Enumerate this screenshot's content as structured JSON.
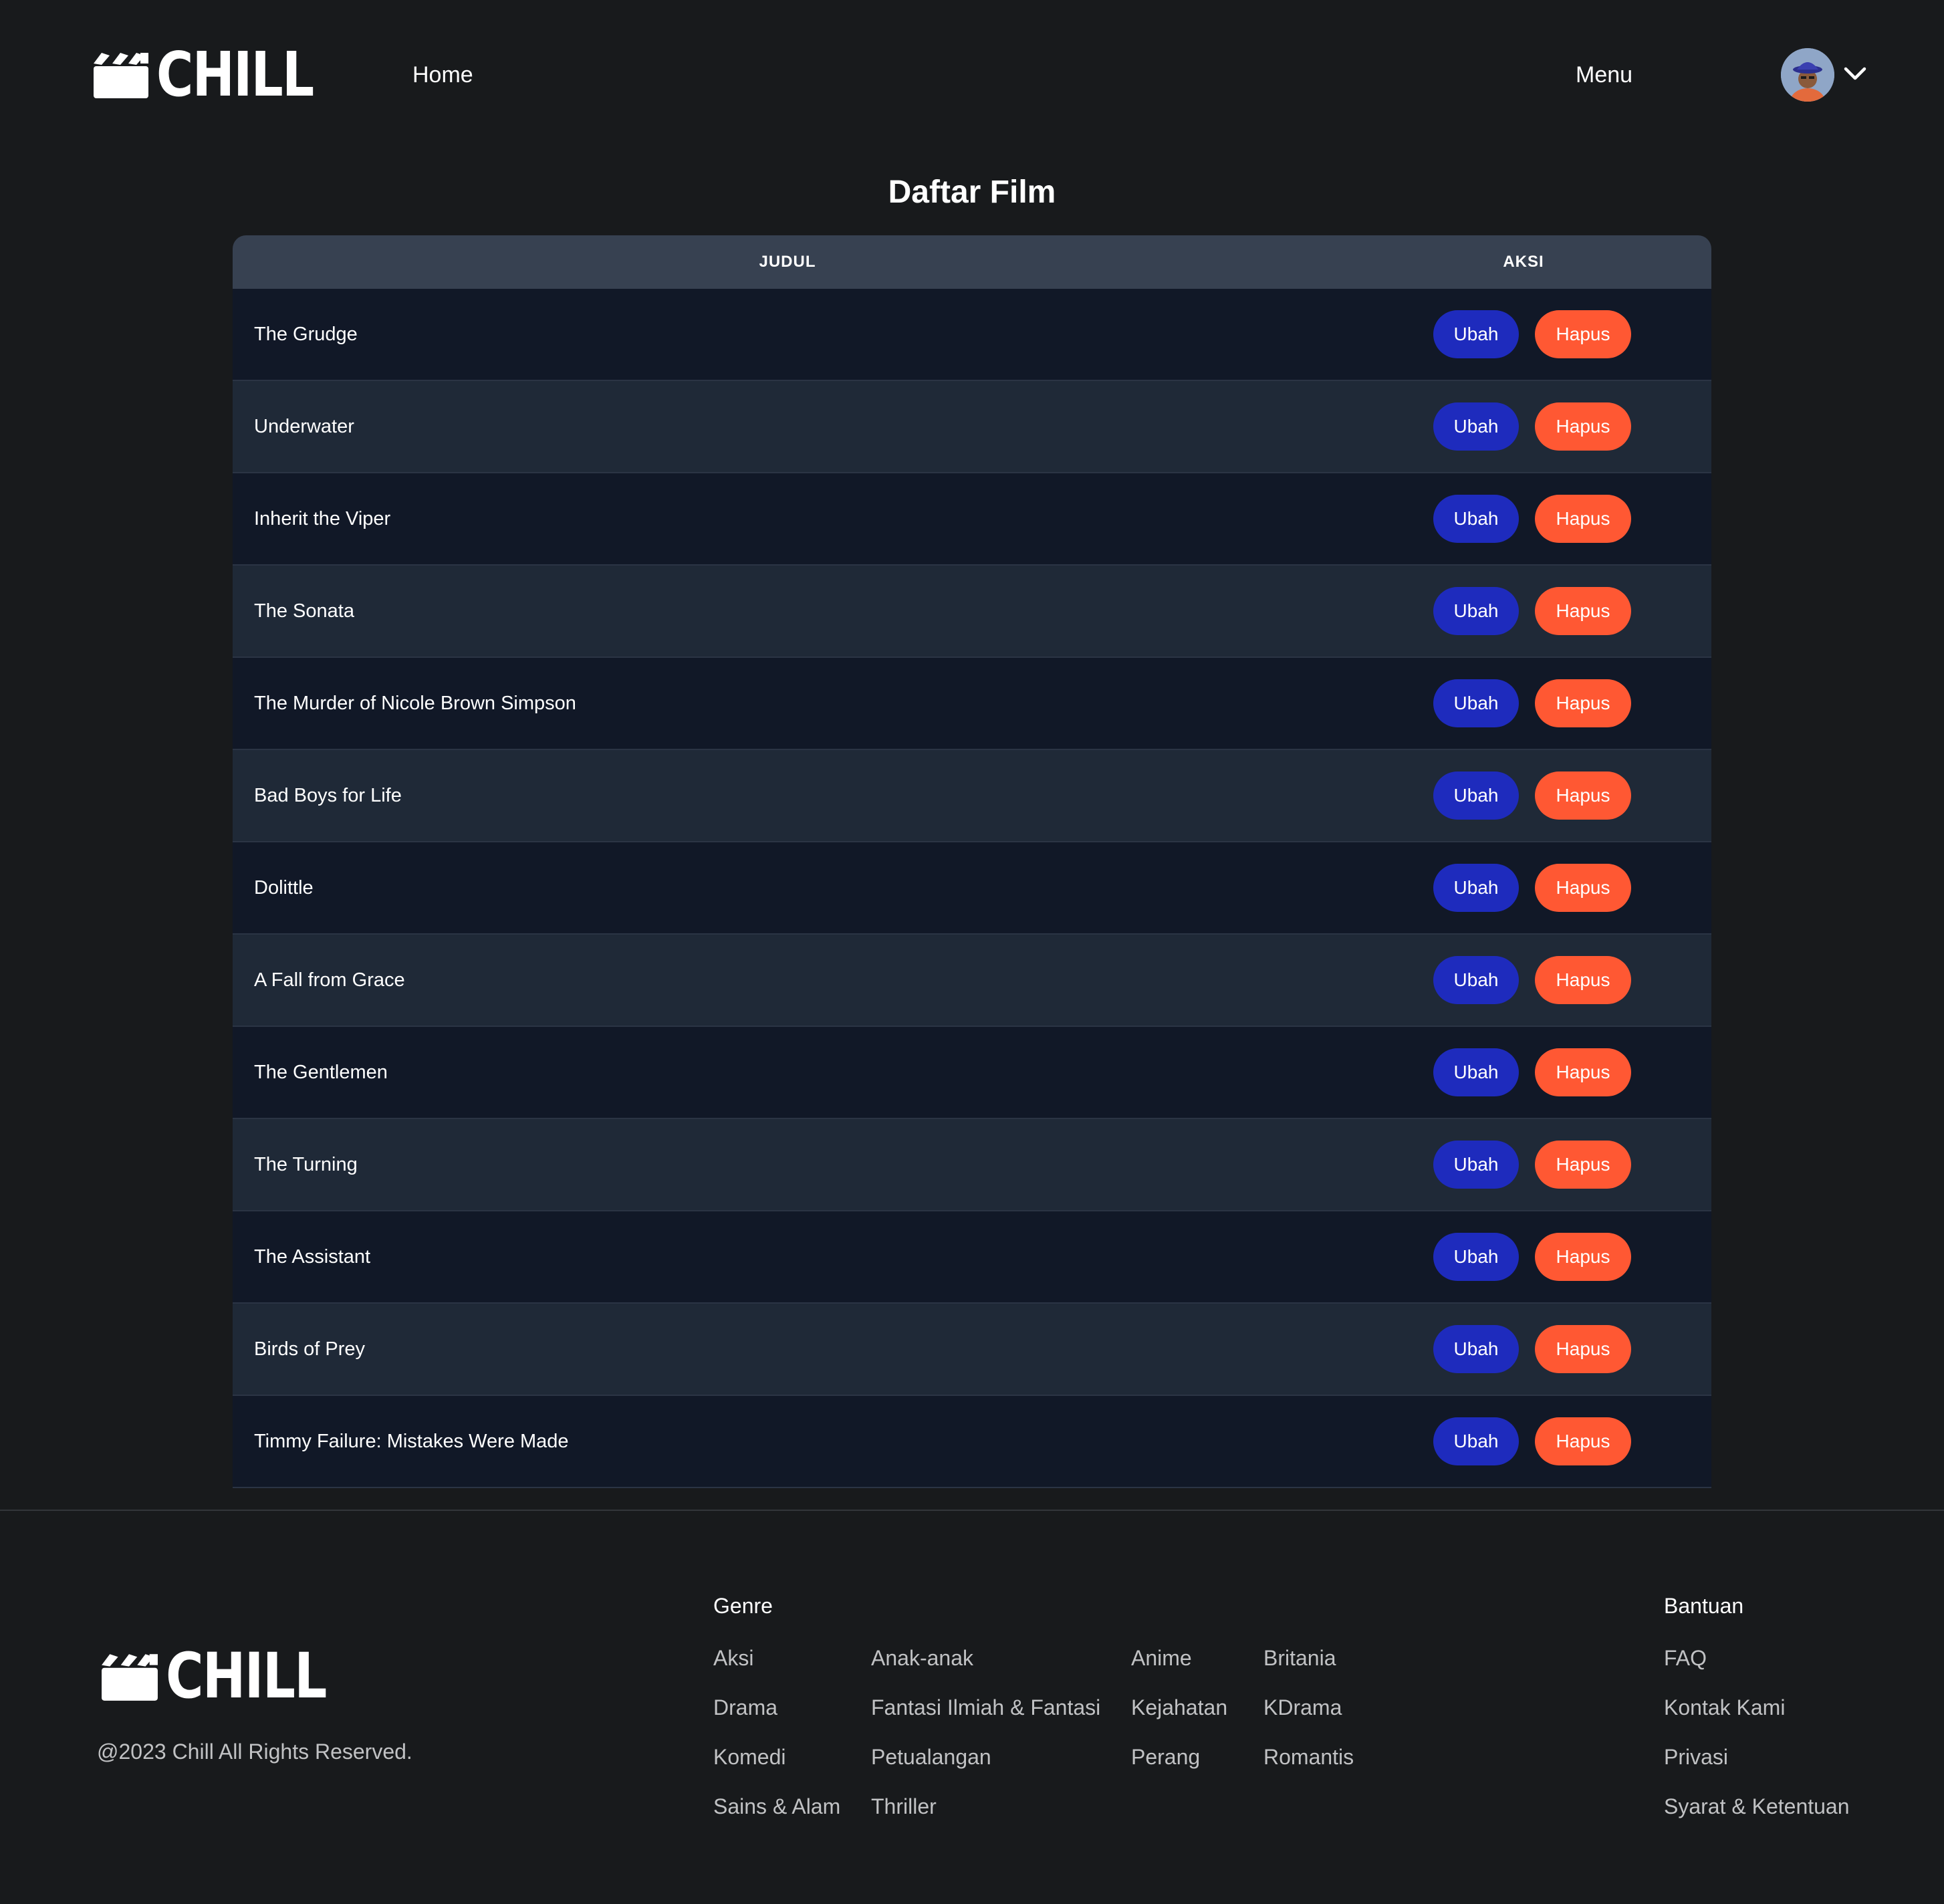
{
  "brand": {
    "name": "CHILL"
  },
  "header": {
    "nav_home": "Home",
    "nav_menu": "Menu"
  },
  "main": {
    "page_title": "Daftar Film",
    "table": {
      "columns": [
        "JUDUL",
        "AKSI"
      ],
      "edit_label": "Ubah",
      "delete_label": "Hapus",
      "rows": [
        "The Grudge",
        "Underwater",
        "Inherit the Viper",
        "The Sonata",
        "The Murder of Nicole Brown Simpson",
        "Bad Boys for Life",
        "Dolittle",
        "A Fall from Grace",
        "The Gentlemen",
        "The Turning",
        "The Assistant",
        "Birds of Prey",
        "Timmy Failure: Mistakes Were Made"
      ]
    }
  },
  "footer": {
    "copyright": "@2023 Chill All Rights Reserved.",
    "genre_title": "Genre",
    "genres": [
      [
        "Aksi",
        "Anak-anak",
        "Anime",
        "Britania"
      ],
      [
        "Drama",
        "Fantasi Ilmiah & Fantasi",
        "Kejahatan",
        "KDrama"
      ],
      [
        "Komedi",
        "Petualangan",
        "Perang",
        "Romantis"
      ],
      [
        "Sains & Alam",
        "Thriller"
      ]
    ],
    "help_title": "Bantuan",
    "help_links": [
      "FAQ",
      "Kontak Kami",
      "Privasi",
      "Syarat & Ketentuan"
    ]
  },
  "colors": {
    "background": "#181a1c",
    "table_header": "#374151",
    "row_odd": "#111827",
    "row_even": "#1f2937",
    "edit_button": "#1e2bbd",
    "delete_button": "#ff5833"
  }
}
